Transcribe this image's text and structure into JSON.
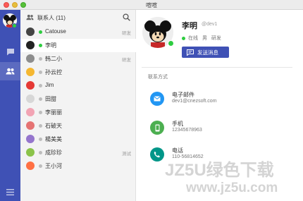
{
  "window": {
    "title": "喧喧"
  },
  "contacts": {
    "header_title": "联系人 (11)",
    "items": [
      {
        "name": "Catouse",
        "tag": "研发",
        "online": true
      },
      {
        "name": "李明",
        "tag": "",
        "online": true,
        "selected": true
      },
      {
        "name": "韩二小",
        "tag": "研发",
        "online": false
      },
      {
        "name": "孙云控",
        "tag": "",
        "online": false
      },
      {
        "name": "Jim",
        "tag": "",
        "online": false
      },
      {
        "name": "田甜",
        "tag": "",
        "online": false
      },
      {
        "name": "李丽丽",
        "tag": "",
        "online": false
      },
      {
        "name": "石破天",
        "tag": "",
        "online": false
      },
      {
        "name": "楊美美",
        "tag": "",
        "online": false
      },
      {
        "name": "成珍珍",
        "tag": "测试",
        "online": false
      },
      {
        "name": "王小河",
        "tag": "",
        "online": false
      }
    ]
  },
  "profile": {
    "name": "李明",
    "account": "@dev1",
    "status": "在线",
    "gender": "男",
    "dept": "研发",
    "send_label": "发送消息",
    "section_title": "联系方式",
    "email_label": "电子邮件",
    "email_value": "dev1@cnezsoft.com",
    "phone_label": "手机",
    "phone_value": "12345678963",
    "tel_label": "电话",
    "tel_value": "110-56814652"
  },
  "watermark": {
    "line1": "JZ5U绿色下载",
    "line2": "www.jz5u.com"
  },
  "colors": {
    "nav": "#3f51b5",
    "online": "#2ecc40",
    "email": "#2196f3",
    "phone": "#4caf50",
    "tel": "#009688"
  }
}
